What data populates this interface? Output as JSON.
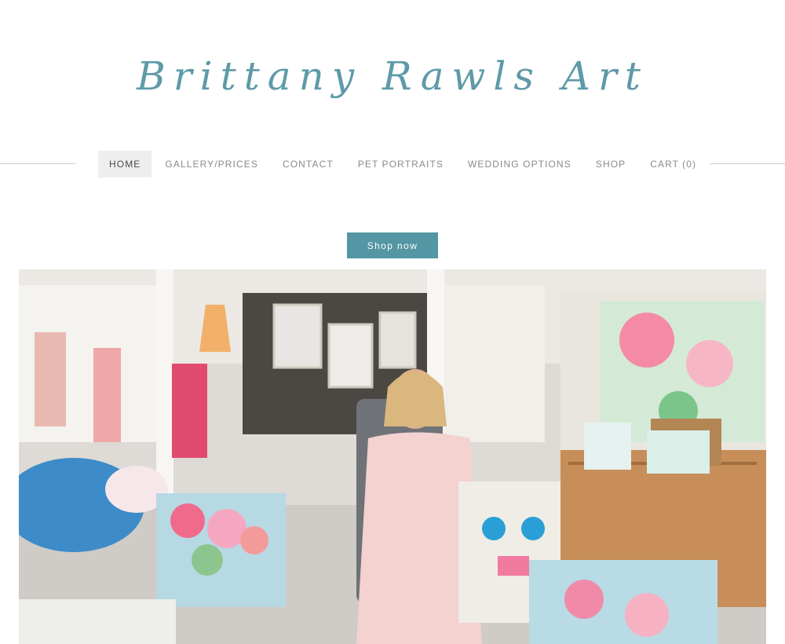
{
  "site": {
    "title": "Brittany Rawls Art"
  },
  "nav": {
    "items": [
      {
        "label": "HOME",
        "active": true
      },
      {
        "label": "GALLERY/PRICES",
        "active": false
      },
      {
        "label": "CONTACT",
        "active": false
      },
      {
        "label": "PET PORTRAITS",
        "active": false
      },
      {
        "label": "WEDDING OPTIONS",
        "active": false
      },
      {
        "label": "SHOP",
        "active": false
      }
    ],
    "cart": {
      "label": "CART",
      "count": "(0)"
    }
  },
  "hero": {
    "button_label": "Shop now"
  },
  "colors": {
    "accent": "#5496a3",
    "title": "#5e9aa8",
    "nav_active_bg": "#eeeeee"
  }
}
